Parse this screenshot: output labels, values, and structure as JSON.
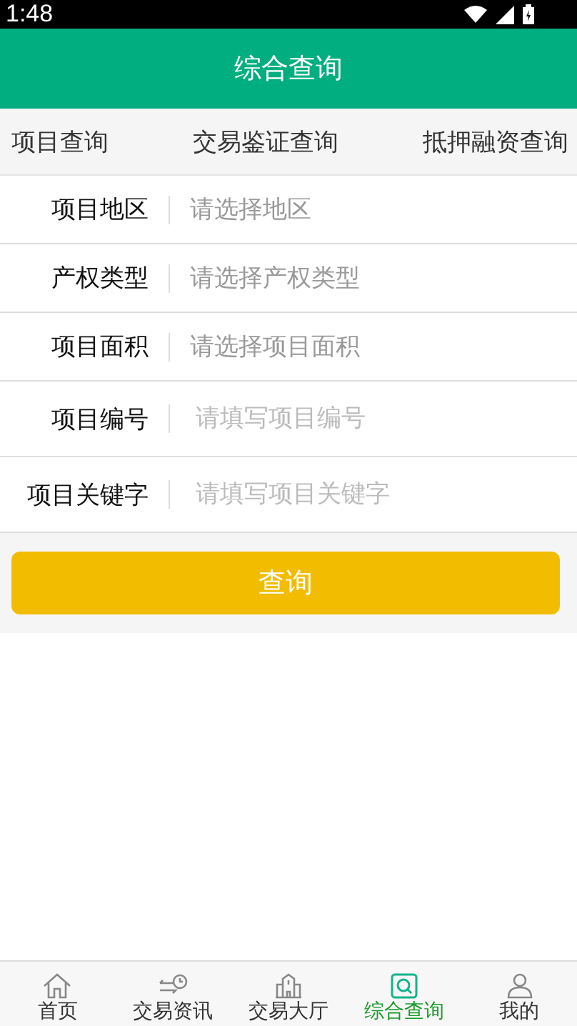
{
  "status_bar": {
    "time": "1:48"
  },
  "header": {
    "title": "综合查询"
  },
  "tabs": [
    {
      "label": "项目查询"
    },
    {
      "label": "交易鉴证查询"
    },
    {
      "label": "抵押融资查询"
    }
  ],
  "fields": [
    {
      "label": "项目地区",
      "placeholder": "请选择地区",
      "kind": "select"
    },
    {
      "label": "产权类型",
      "placeholder": "请选择产权类型",
      "kind": "select"
    },
    {
      "label": "项目面积",
      "placeholder": "请选择项目面积",
      "kind": "select"
    },
    {
      "label": "项目编号",
      "placeholder": "请填写项目编号",
      "kind": "text"
    },
    {
      "label": "项目关键字",
      "placeholder": "请填写项目关键字",
      "kind": "text"
    }
  ],
  "submit": {
    "label": "查询"
  },
  "nav": [
    {
      "label": "首页",
      "kind": "home",
      "selected": false
    },
    {
      "label": "交易资讯",
      "kind": "news",
      "selected": false
    },
    {
      "label": "交易大厅",
      "kind": "hall",
      "selected": false
    },
    {
      "label": "综合查询",
      "kind": "search",
      "selected": true
    },
    {
      "label": "我的",
      "kind": "user",
      "selected": false
    }
  ]
}
